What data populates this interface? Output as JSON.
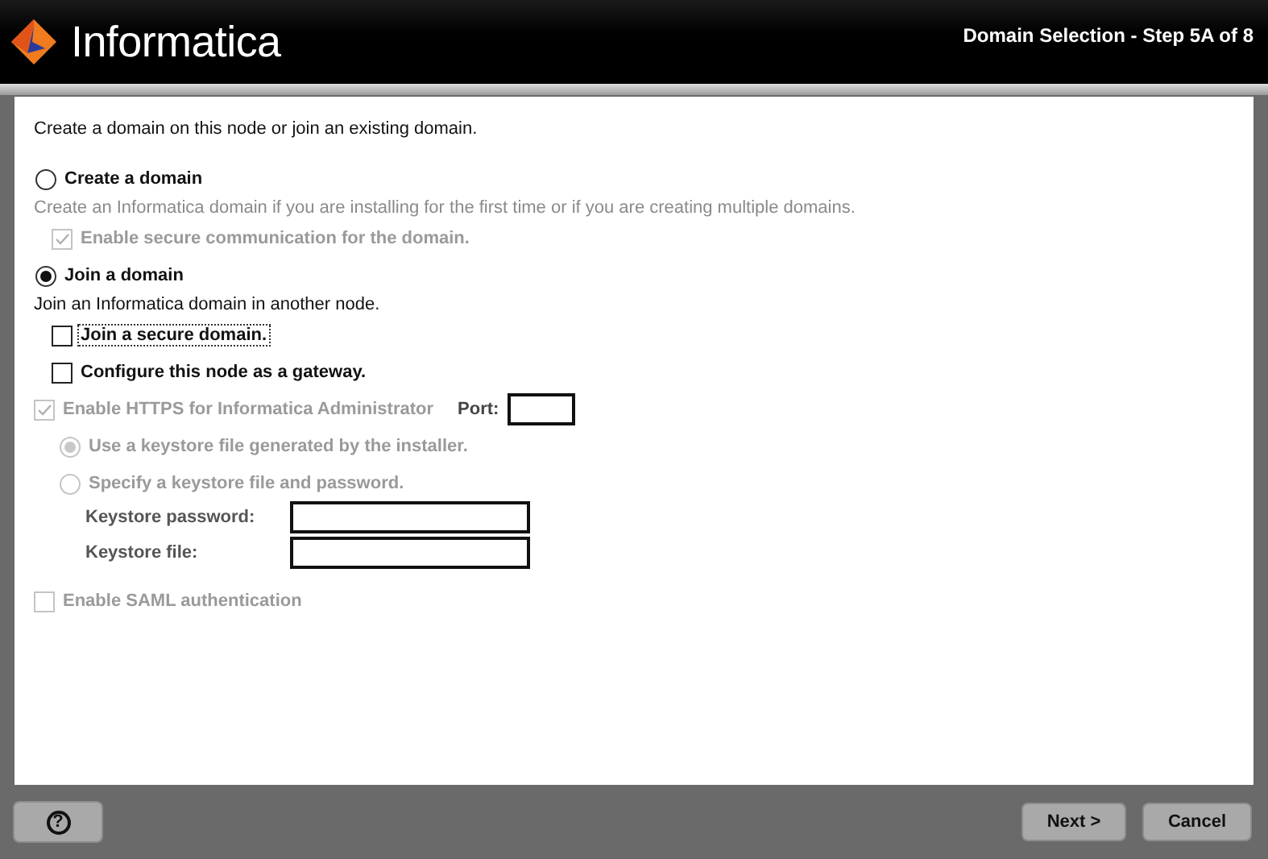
{
  "header": {
    "logo": "Informatica",
    "step": "Domain Selection - Step 5A of 8"
  },
  "intro": "Create a domain on this node or join an existing domain.",
  "domain_choices": [
    {
      "label": "Create a domain",
      "selected": false,
      "description": "Create an Informatica domain if you are installing for the first time or if you are creating multiple domains.",
      "options": [
        {
          "label": "Enable secure communication for the domain.",
          "checked": true,
          "disabled": true,
          "focused": false
        }
      ]
    },
    {
      "label": "Join a domain",
      "selected": true,
      "description": "Join an Informatica domain in another node.",
      "options": [
        {
          "label": "Join a secure domain.",
          "checked": false,
          "disabled": false,
          "focused": true
        },
        {
          "label": "Configure this node as a gateway.",
          "checked": false,
          "disabled": false,
          "focused": false
        }
      ]
    }
  ],
  "https": {
    "label": "Enable HTTPS for Informatica Administrator",
    "checked": true,
    "disabled": true,
    "port_label": "Port:",
    "keystore_choices": [
      {
        "label": "Use a keystore file generated by the installer.",
        "selected": true,
        "disabled": true
      },
      {
        "label": "Specify a keystore file and password.",
        "selected": false,
        "disabled": true
      }
    ],
    "keystore_fields": [
      {
        "label": "Keystore password:"
      },
      {
        "label": "Keystore file:"
      }
    ]
  },
  "saml": {
    "label": "Enable SAML authentication",
    "checked": false,
    "disabled": true
  },
  "buttons": {
    "help": "?",
    "next": "Next >",
    "cancel": "Cancel"
  }
}
